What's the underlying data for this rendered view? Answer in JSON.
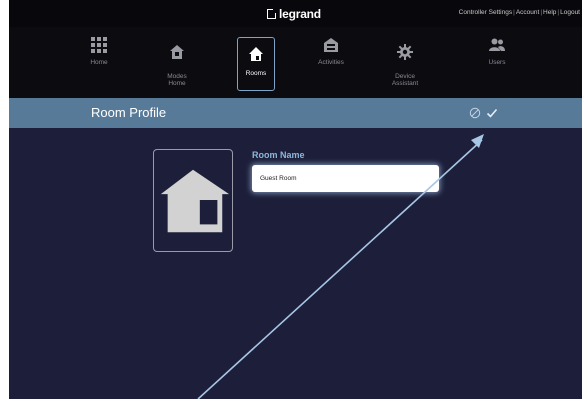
{
  "brand": {
    "logo_text": "legrand"
  },
  "top_links": [
    "Controller Settings",
    "Account",
    "Help",
    "Logout"
  ],
  "top_links_separator": "|",
  "nav": {
    "items": [
      {
        "label": "Home",
        "icon": "grid-icon",
        "active": false
      },
      {
        "label": "Modes\nHome",
        "icon": "modes-icon",
        "active": false
      },
      {
        "label": "Rooms",
        "icon": "house-icon",
        "active": true
      },
      {
        "label": "Activities",
        "icon": "activities-icon",
        "active": false
      },
      {
        "label": "Device\nAssistant",
        "icon": "gear-icon",
        "active": false
      },
      {
        "label": "Users",
        "icon": "users-icon",
        "active": false
      }
    ]
  },
  "profile": {
    "title": "Room Profile",
    "cancel_icon": "cancel-icon",
    "confirm_icon": "check-icon",
    "room_image_icon": "house-icon"
  },
  "form": {
    "room_name_label": "Room Name",
    "room_name_value": "Guest Room"
  },
  "colors": {
    "background": "#1d1f3a",
    "header_bar": "#587a99",
    "accent": "#8fb6dc"
  }
}
